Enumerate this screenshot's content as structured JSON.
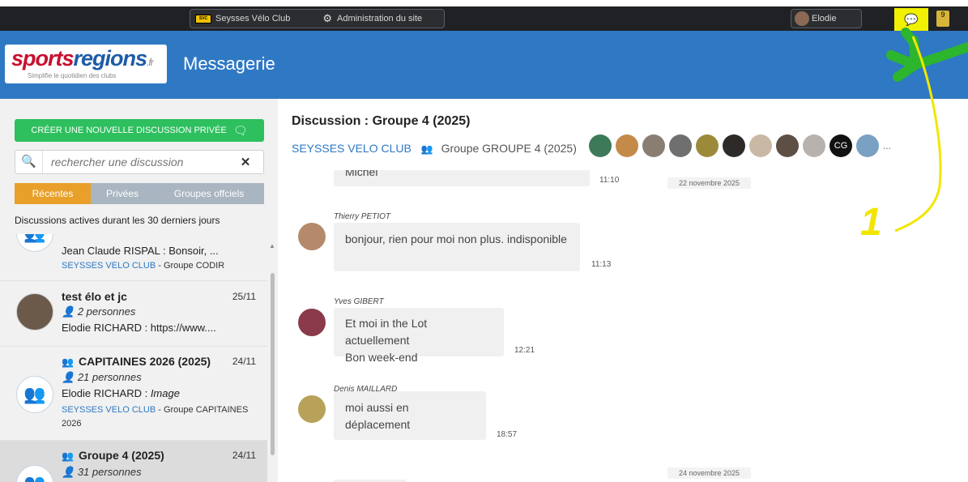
{
  "topbar": {
    "club_name": "Seysses Vélo Club",
    "admin_label": "Administration du site",
    "user_name": "Elodie",
    "notification_count": "9"
  },
  "header": {
    "logo_text_sports": "sports",
    "logo_text_regions": "regions",
    "logo_suffix": ".fr",
    "logo_tagline": "Simplifie le quotidien des clubs",
    "page_title": "Messagerie"
  },
  "sidebar": {
    "new_discussion_label": "CRÉER UNE NOUVELLE DISCUSSION PRIVÉE",
    "search_placeholder": "rechercher une discussion",
    "tabs": [
      "Récentes",
      "Privées",
      "Groupes offciels"
    ],
    "active_note": "Discussions actives durant les 30 derniers jours",
    "conversations": [
      {
        "last": "Jean Claude RISPAL :  Bonsoir, ...",
        "club": "SEYSSES VELO CLUB",
        "group": " - Groupe CODIR"
      },
      {
        "title": "test élo et jc",
        "date": "25/11",
        "people": "2 personnes",
        "last": "Elodie RICHARD :  https://www...."
      },
      {
        "title": "CAPITAINES 2026 (2025)",
        "date": "24/11",
        "people": "21 personnes",
        "last_author": "Elodie RICHARD : ",
        "last_text": "Image",
        "club": "SEYSSES VELO CLUB",
        "group": " - Groupe CAPITAINES",
        "group2": "2026"
      },
      {
        "title": "Groupe 4 (2025)",
        "date": "24/11",
        "people": "31 personnes"
      }
    ]
  },
  "discussion": {
    "title_prefix": "Discussion : ",
    "title": "Groupe 4 (2025)",
    "club": "SEYSSES VELO CLUB",
    "group": "Groupe GROUPE 4 (2025)",
    "member_initials": "CG",
    "more": "...",
    "messages": [
      {
        "author": "",
        "text": "Michel",
        "time": "11:10",
        "day": "22 novembre 2025"
      },
      {
        "author": "Thierry PETIOT",
        "text": "bonjour, rien pour moi non plus. indisponible",
        "time": "11:13"
      },
      {
        "author": "Yves GIBERT",
        "text_line1": "Et moi in the Lot actuellement",
        "text_line2": "Bon week-end",
        "time": "12:21"
      },
      {
        "author": "Denis MAILLARD",
        "text": "moi aussi en déplacement",
        "time": "18:57"
      },
      {
        "day": "24 novembre 2025"
      }
    ]
  },
  "annotation": {
    "number": "1"
  },
  "colors": {
    "brand_blue": "#2f78c4",
    "topbar": "#1f2124",
    "create_button": "#2ebf5e",
    "active_tab": "#e8a02a",
    "inactive_tab": "#a9b5c1",
    "highlight": "#f0f000",
    "annotation_yellow": "#f2e600",
    "annotation_green": "#2db52d"
  }
}
